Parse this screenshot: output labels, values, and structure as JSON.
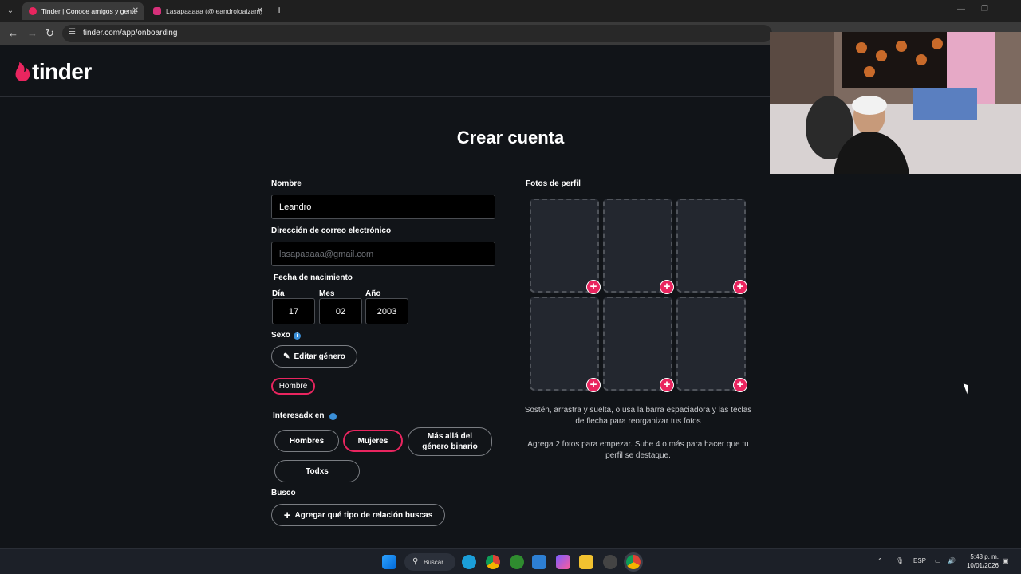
{
  "browser": {
    "tabs": [
      {
        "title": "Tinder | Conoce amigos y gente",
        "active": true
      },
      {
        "title": "Lasapaaaaa (@leandroloaizam)",
        "active": false
      }
    ],
    "url": "tinder.com/app/onboarding"
  },
  "brand": {
    "name": "tinder",
    "accent": "#e9255f"
  },
  "page_title": "Crear cuenta",
  "form": {
    "name_label": "Nombre",
    "name_value": "Leandro",
    "email_label": "Dirección de correo electrónico",
    "email_placeholder": "lasapaaaaa@gmail.com",
    "birthdate_label": "Fecha de nacimiento",
    "day_label": "Día",
    "day_value": "17",
    "month_label": "Mes",
    "month_value": "02",
    "year_label": "Año",
    "year_value": "2003",
    "sex_label": "Sexo",
    "edit_gender_label": "Editar género",
    "selected_gender": "Hombre",
    "interested_label": "Interesadx en",
    "interested_options": [
      {
        "label": "Hombres",
        "selected": false
      },
      {
        "label": "Mujeres",
        "selected": true
      },
      {
        "label": "Más allá del género binario",
        "selected": false
      },
      {
        "label": "Todxs",
        "selected": false
      }
    ],
    "looking_label": "Busco",
    "looking_button": "Agregar qué tipo de relación buscas"
  },
  "photos": {
    "label": "Fotos de perfil",
    "slot_count": 6,
    "hint_reorder": "Sostén, arrastra y suelta, o usa la barra espaciadora y las teclas de flecha para reorganizar tus fotos",
    "hint_count": "Agrega 2 fotos para empezar. Sube 4 o más para hacer que tu perfil se destaque."
  },
  "taskbar": {
    "search_label": "Buscar",
    "language": "ESP",
    "time": "5:48 p. m.",
    "date": "10/01/2026"
  }
}
